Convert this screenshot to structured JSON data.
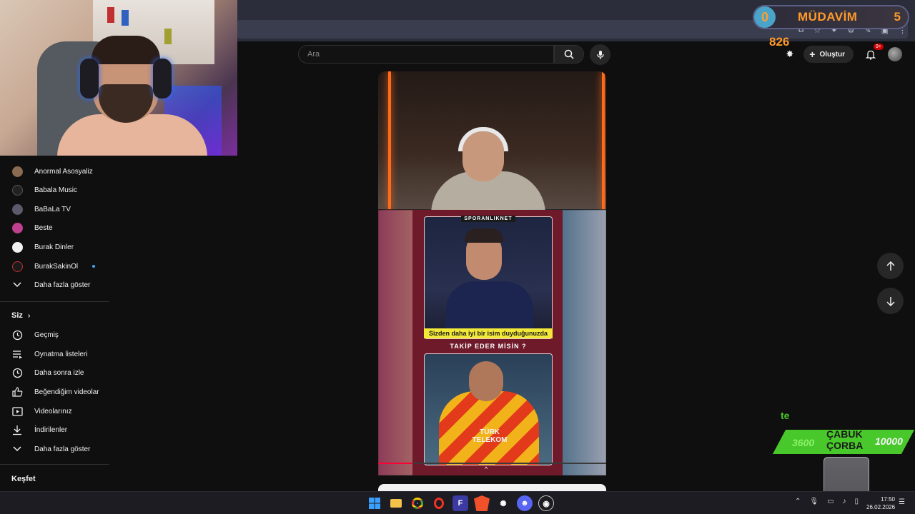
{
  "search": {
    "placeholder": "Ara"
  },
  "header": {
    "create_label": "Oluştur",
    "notifications_badge": "9+"
  },
  "overlay": {
    "regular_title": "MÜDAVİM",
    "regular_left_count": "0",
    "regular_right_count": "5",
    "score": "826",
    "ticker_left": "3600",
    "ticker_title_line1": "ÇABUK",
    "ticker_title_line2": "ÇORBA",
    "ticker_right": "10000",
    "ticker_fragment": "te"
  },
  "sidebar": {
    "subscriptions": [
      {
        "label": "Anormal Asosyaliz",
        "avatar_color": "#8a6a50"
      },
      {
        "label": "Babala Music",
        "avatar_color": "#222222"
      },
      {
        "label": "BaBaLa TV",
        "avatar_color": "#5a5a6a"
      },
      {
        "label": "Beste",
        "avatar_color": "#c04090"
      },
      {
        "label": "Burak Dinler",
        "avatar_color": "#f1f1f1"
      },
      {
        "label": "BurakSakinOl",
        "avatar_color": "#1a1a1a"
      }
    ],
    "show_more_1": "Daha fazla göster",
    "you_heading": "Siz",
    "you_items": [
      {
        "label": "Geçmiş",
        "icon": "history-icon"
      },
      {
        "label": "Oynatma listeleri",
        "icon": "playlist-icon"
      },
      {
        "label": "Daha sonra izle",
        "icon": "clock-icon"
      },
      {
        "label": "Beğendiğim videolar",
        "icon": "like-icon"
      },
      {
        "label": "Videolarınız",
        "icon": "your-videos-icon"
      },
      {
        "label": "İndirilenler",
        "icon": "download-icon"
      }
    ],
    "show_more_2": "Daha fazla göster",
    "explore_heading": "Keşfet"
  },
  "video": {
    "source_tag": "SPORANLIKNET",
    "caption_1": "Sizden daha iyi bir isim duyduğunuzda",
    "caption_2": "TAKİP EDER MİSİN ?",
    "jersey_sponsor_1": "TÜRK",
    "jersey_sponsor_2": "TELEKOM",
    "progress_fraction": 0.15
  },
  "taskbar": {
    "time": "17:50",
    "date": "26.02.2026"
  },
  "colors": {
    "accent_red": "#ff0033",
    "overlay_orange": "#ff9a2a",
    "overlay_green": "#48c82a"
  }
}
